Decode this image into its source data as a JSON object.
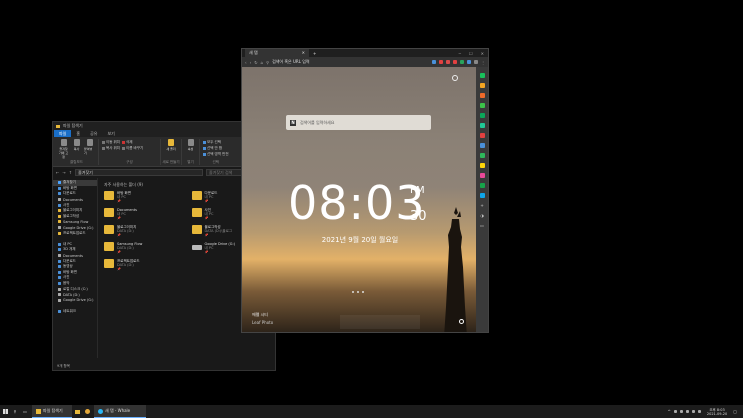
{
  "explorer": {
    "title": "파일 탐색기",
    "tabs": [
      "파일",
      "홈",
      "공유",
      "보기"
    ],
    "ribbon_groups": [
      {
        "name": "클립보드",
        "buttons": [
          "즐겨찾기에 고정",
          "복사",
          "붙여넣기"
        ]
      },
      {
        "name": "구성",
        "small": [
          "이동 위치",
          "복사 위치",
          "삭제",
          "이름 바꾸기"
        ]
      },
      {
        "name": "새로 만들기",
        "buttons": [
          "새 폴더"
        ]
      },
      {
        "name": "열기",
        "buttons": [
          "속성"
        ]
      },
      {
        "name": "선택",
        "small": [
          "모두 선택",
          "선택 안 함",
          "선택 영역 반전"
        ]
      }
    ],
    "address": "즐겨찾기",
    "search_placeholder": "즐겨찾기 검색",
    "nav": [
      {
        "label": "즐겨찾기",
        "color": "#4aa3ff",
        "active": true
      },
      {
        "label": "바탕 화면",
        "color": "#4a90d9"
      },
      {
        "label": "다운로드",
        "color": "#4a90d9"
      },
      {
        "label": "Documents",
        "color": "#aaa"
      },
      {
        "label": "사진",
        "color": "#4a90d9"
      },
      {
        "label": "블로그이미지",
        "color": "#e7b83a"
      },
      {
        "label": "블로그작성",
        "color": "#e7b83a"
      },
      {
        "label": "Samsung Flow",
        "color": "#e7b83a"
      },
      {
        "label": "Google Drive (G:)",
        "color": "#aaa"
      },
      {
        "label": "프로젝트업로드",
        "color": "#e7b83a"
      },
      {
        "label": "",
        "color": "transparent"
      },
      {
        "label": "내 PC",
        "color": "#4a90d9"
      },
      {
        "label": "3D 개체",
        "color": "#4a90d9"
      },
      {
        "label": "Documents",
        "color": "#aaa"
      },
      {
        "label": "다운로드",
        "color": "#4a90d9"
      },
      {
        "label": "동영상",
        "color": "#4a90d9"
      },
      {
        "label": "바탕 화면",
        "color": "#4a90d9"
      },
      {
        "label": "사진",
        "color": "#4a90d9"
      },
      {
        "label": "음악",
        "color": "#4a90d9"
      },
      {
        "label": "로컬 디스크 (C:)",
        "color": "#aaa"
      },
      {
        "label": "DATA (D:)",
        "color": "#aaa"
      },
      {
        "label": "Google Drive (G:)",
        "color": "#aaa"
      },
      {
        "label": "",
        "color": "transparent"
      },
      {
        "label": "네트워크",
        "color": "#4a90d9"
      }
    ],
    "section_title": "자주 사용하는 폴더 (9)",
    "tiles": [
      {
        "name": "바탕 화면",
        "sub": "내 PC",
        "drive": false
      },
      {
        "name": "다운로드",
        "sub": "내 PC",
        "drive": false
      },
      {
        "name": "Documents",
        "sub": "내 PC",
        "drive": false
      },
      {
        "name": "사진",
        "sub": "내 PC",
        "drive": false
      },
      {
        "name": "블로그이미지",
        "sub": "DATA (D:)",
        "drive": false
      },
      {
        "name": "블로그작성",
        "sub": "DATA (D:)\\블로그",
        "drive": false
      },
      {
        "name": "Samsung Flow",
        "sub": "DATA (D:)",
        "drive": false
      },
      {
        "name": "Google Drive (G:)",
        "sub": "내 PC",
        "drive": true
      },
      {
        "name": "프로젝트업로드",
        "sub": "DATA (D:)",
        "drive": false
      }
    ],
    "status": "9개 항목"
  },
  "browser": {
    "tab_title": "새 탭",
    "url_placeholder": "검색어 혹은 URL 입력",
    "naver_letter": "N",
    "search_placeholder": "검색어를 입력하세요",
    "time": "08:03",
    "ampm": "PM",
    "seconds": "30",
    "date": "2021년 9월 20일 월요일",
    "weather": "에펠 시티",
    "weather_sub": "Leaf Photo",
    "sidebar_colors": [
      "#18c15c",
      "#f5a623",
      "#f06a2a",
      "#3cc34a",
      "#0ba75a",
      "#20c997",
      "#e34040",
      "#4a90d9",
      "#2eb85c",
      "#ffd60a",
      "#ec4899",
      "#16a34a",
      "#0ea5e9"
    ],
    "ext_colors": [
      "#4a90d9",
      "#e34040",
      "#d94a4a",
      "#e34040",
      "#29a35c",
      "#4a90d9",
      "#888"
    ]
  },
  "taskbar": {
    "apps": [
      {
        "label": "파일 탐색기",
        "color": "#e7b83a"
      },
      {
        "label": "새 탭 - Whale",
        "color": "#29b6f6"
      }
    ],
    "time": "오후 8:03",
    "date": "2021-09-20"
  }
}
